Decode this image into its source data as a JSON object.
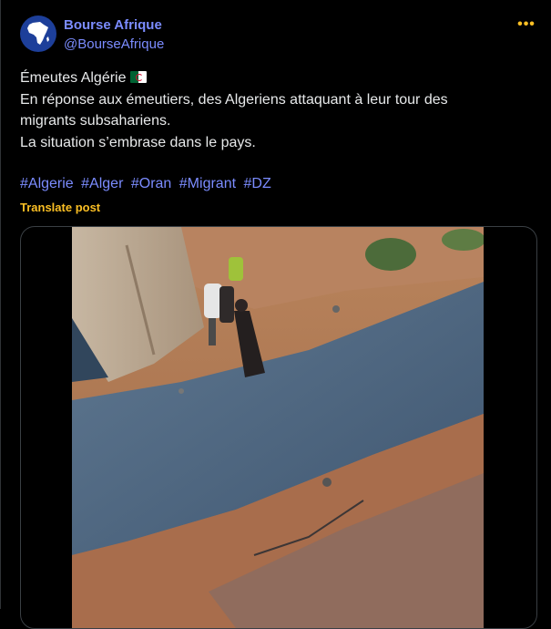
{
  "author": {
    "display_name": "Bourse Afrique",
    "handle": "@BourseAfrique",
    "avatar_icon": "africa-map-icon"
  },
  "more_icon": "more-options-icon",
  "post": {
    "line1": "Émeutes Algérie",
    "line1_flag": "algeria-flag-icon",
    "line2": "En réponse aux émeutiers, des Algeriens attaquant à leur tour des",
    "line3": "migrants subsahariens.",
    "line4": "La situation s’embrase dans le pays.",
    "hashtags": [
      "#Algerie",
      "#Alger",
      "#Oran",
      "#Migrant",
      "#DZ"
    ]
  },
  "translate_label": "Translate post",
  "colors": {
    "accent": "#7b8cff",
    "translate": "#fbbf24",
    "background": "#000000"
  }
}
